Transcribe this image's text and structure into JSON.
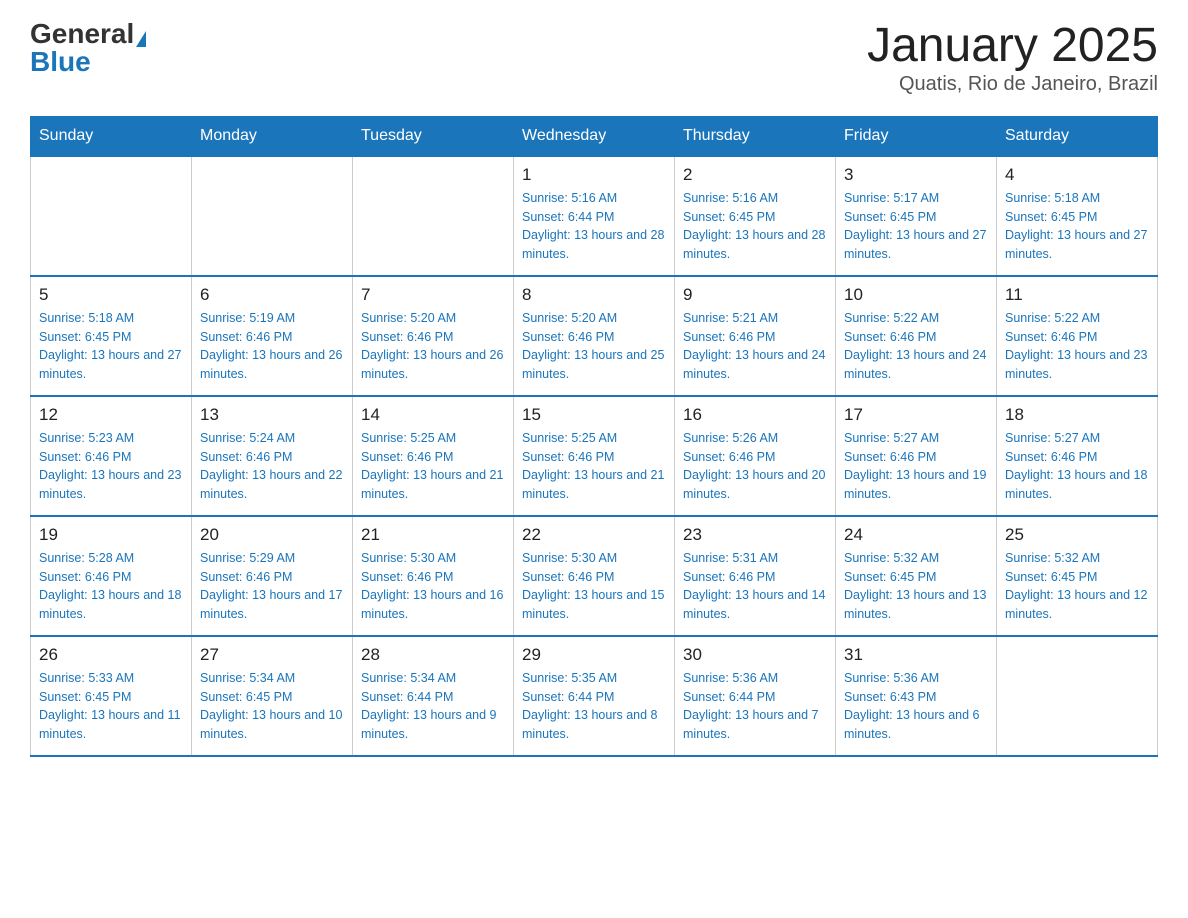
{
  "header": {
    "logo_general": "General",
    "logo_blue": "Blue",
    "month_title": "January 2025",
    "location": "Quatis, Rio de Janeiro, Brazil"
  },
  "days_of_week": [
    "Sunday",
    "Monday",
    "Tuesday",
    "Wednesday",
    "Thursday",
    "Friday",
    "Saturday"
  ],
  "weeks": [
    [
      {
        "day": "",
        "info": ""
      },
      {
        "day": "",
        "info": ""
      },
      {
        "day": "",
        "info": ""
      },
      {
        "day": "1",
        "info": "Sunrise: 5:16 AM\nSunset: 6:44 PM\nDaylight: 13 hours and 28 minutes."
      },
      {
        "day": "2",
        "info": "Sunrise: 5:16 AM\nSunset: 6:45 PM\nDaylight: 13 hours and 28 minutes."
      },
      {
        "day": "3",
        "info": "Sunrise: 5:17 AM\nSunset: 6:45 PM\nDaylight: 13 hours and 27 minutes."
      },
      {
        "day": "4",
        "info": "Sunrise: 5:18 AM\nSunset: 6:45 PM\nDaylight: 13 hours and 27 minutes."
      }
    ],
    [
      {
        "day": "5",
        "info": "Sunrise: 5:18 AM\nSunset: 6:45 PM\nDaylight: 13 hours and 27 minutes."
      },
      {
        "day": "6",
        "info": "Sunrise: 5:19 AM\nSunset: 6:46 PM\nDaylight: 13 hours and 26 minutes."
      },
      {
        "day": "7",
        "info": "Sunrise: 5:20 AM\nSunset: 6:46 PM\nDaylight: 13 hours and 26 minutes."
      },
      {
        "day": "8",
        "info": "Sunrise: 5:20 AM\nSunset: 6:46 PM\nDaylight: 13 hours and 25 minutes."
      },
      {
        "day": "9",
        "info": "Sunrise: 5:21 AM\nSunset: 6:46 PM\nDaylight: 13 hours and 24 minutes."
      },
      {
        "day": "10",
        "info": "Sunrise: 5:22 AM\nSunset: 6:46 PM\nDaylight: 13 hours and 24 minutes."
      },
      {
        "day": "11",
        "info": "Sunrise: 5:22 AM\nSunset: 6:46 PM\nDaylight: 13 hours and 23 minutes."
      }
    ],
    [
      {
        "day": "12",
        "info": "Sunrise: 5:23 AM\nSunset: 6:46 PM\nDaylight: 13 hours and 23 minutes."
      },
      {
        "day": "13",
        "info": "Sunrise: 5:24 AM\nSunset: 6:46 PM\nDaylight: 13 hours and 22 minutes."
      },
      {
        "day": "14",
        "info": "Sunrise: 5:25 AM\nSunset: 6:46 PM\nDaylight: 13 hours and 21 minutes."
      },
      {
        "day": "15",
        "info": "Sunrise: 5:25 AM\nSunset: 6:46 PM\nDaylight: 13 hours and 21 minutes."
      },
      {
        "day": "16",
        "info": "Sunrise: 5:26 AM\nSunset: 6:46 PM\nDaylight: 13 hours and 20 minutes."
      },
      {
        "day": "17",
        "info": "Sunrise: 5:27 AM\nSunset: 6:46 PM\nDaylight: 13 hours and 19 minutes."
      },
      {
        "day": "18",
        "info": "Sunrise: 5:27 AM\nSunset: 6:46 PM\nDaylight: 13 hours and 18 minutes."
      }
    ],
    [
      {
        "day": "19",
        "info": "Sunrise: 5:28 AM\nSunset: 6:46 PM\nDaylight: 13 hours and 18 minutes."
      },
      {
        "day": "20",
        "info": "Sunrise: 5:29 AM\nSunset: 6:46 PM\nDaylight: 13 hours and 17 minutes."
      },
      {
        "day": "21",
        "info": "Sunrise: 5:30 AM\nSunset: 6:46 PM\nDaylight: 13 hours and 16 minutes."
      },
      {
        "day": "22",
        "info": "Sunrise: 5:30 AM\nSunset: 6:46 PM\nDaylight: 13 hours and 15 minutes."
      },
      {
        "day": "23",
        "info": "Sunrise: 5:31 AM\nSunset: 6:46 PM\nDaylight: 13 hours and 14 minutes."
      },
      {
        "day": "24",
        "info": "Sunrise: 5:32 AM\nSunset: 6:45 PM\nDaylight: 13 hours and 13 minutes."
      },
      {
        "day": "25",
        "info": "Sunrise: 5:32 AM\nSunset: 6:45 PM\nDaylight: 13 hours and 12 minutes."
      }
    ],
    [
      {
        "day": "26",
        "info": "Sunrise: 5:33 AM\nSunset: 6:45 PM\nDaylight: 13 hours and 11 minutes."
      },
      {
        "day": "27",
        "info": "Sunrise: 5:34 AM\nSunset: 6:45 PM\nDaylight: 13 hours and 10 minutes."
      },
      {
        "day": "28",
        "info": "Sunrise: 5:34 AM\nSunset: 6:44 PM\nDaylight: 13 hours and 9 minutes."
      },
      {
        "day": "29",
        "info": "Sunrise: 5:35 AM\nSunset: 6:44 PM\nDaylight: 13 hours and 8 minutes."
      },
      {
        "day": "30",
        "info": "Sunrise: 5:36 AM\nSunset: 6:44 PM\nDaylight: 13 hours and 7 minutes."
      },
      {
        "day": "31",
        "info": "Sunrise: 5:36 AM\nSunset: 6:43 PM\nDaylight: 13 hours and 6 minutes."
      },
      {
        "day": "",
        "info": ""
      }
    ]
  ]
}
